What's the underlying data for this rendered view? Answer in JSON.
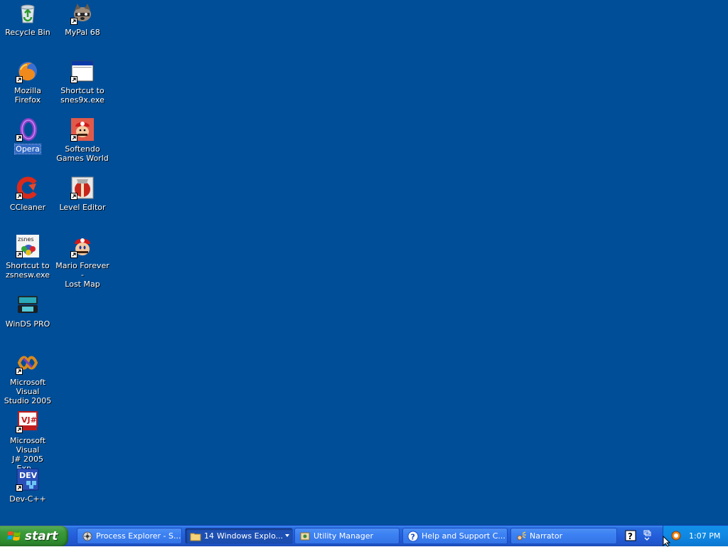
{
  "desktop": {
    "background": "#004e98",
    "icons": [
      {
        "label": "Recycle Bin",
        "icon": "recycle-bin-icon"
      },
      {
        "label": "MyPal 68",
        "icon": "mypal-icon"
      },
      {
        "label": "Mozilla Firefox",
        "icon": "firefox-icon"
      },
      {
        "label": "Shortcut to\nsnes9x.exe",
        "icon": "snes9x-icon"
      },
      {
        "label": "Opera",
        "icon": "opera-icon"
      },
      {
        "label": "Softendo\nGames World",
        "icon": "softendo-icon"
      },
      {
        "label": "CCleaner",
        "icon": "ccleaner-icon"
      },
      {
        "label": "Level Editor",
        "icon": "level-editor-icon"
      },
      {
        "label": "Shortcut to\nzsnesw.exe",
        "icon": "zsnes-icon"
      },
      {
        "label": "Mario Forever -\nLost Map",
        "icon": "mario-icon"
      },
      {
        "label": "WinDS PRO",
        "icon": "winds-icon"
      },
      {
        "label": "Microsoft Visual\nStudio 2005",
        "icon": "visual-studio-icon"
      },
      {
        "label": "Microsoft Visual\nJ# 2005 Exp...",
        "icon": "visual-jsharp-icon"
      },
      {
        "label": "Dev-C++",
        "icon": "devcpp-icon"
      }
    ],
    "selected": "Opera"
  },
  "taskbar": {
    "start_label": "start",
    "tasks": [
      {
        "label": "Process Explorer - S...",
        "icon": "process-explorer-icon"
      },
      {
        "count": "14",
        "label": "Windows Explo...",
        "icon": "folder-icon"
      },
      {
        "label": "Utility Manager",
        "icon": "utility-manager-icon"
      },
      {
        "label": "Help and Support C...",
        "icon": "help-icon"
      },
      {
        "label": "Narrator",
        "icon": "narrator-icon"
      }
    ],
    "clock": "1:07 PM"
  },
  "colors": {
    "taskbar": "#245edb",
    "start": "#3c9a3c",
    "tray": "#0f88e3",
    "selection": "#316ac5"
  }
}
